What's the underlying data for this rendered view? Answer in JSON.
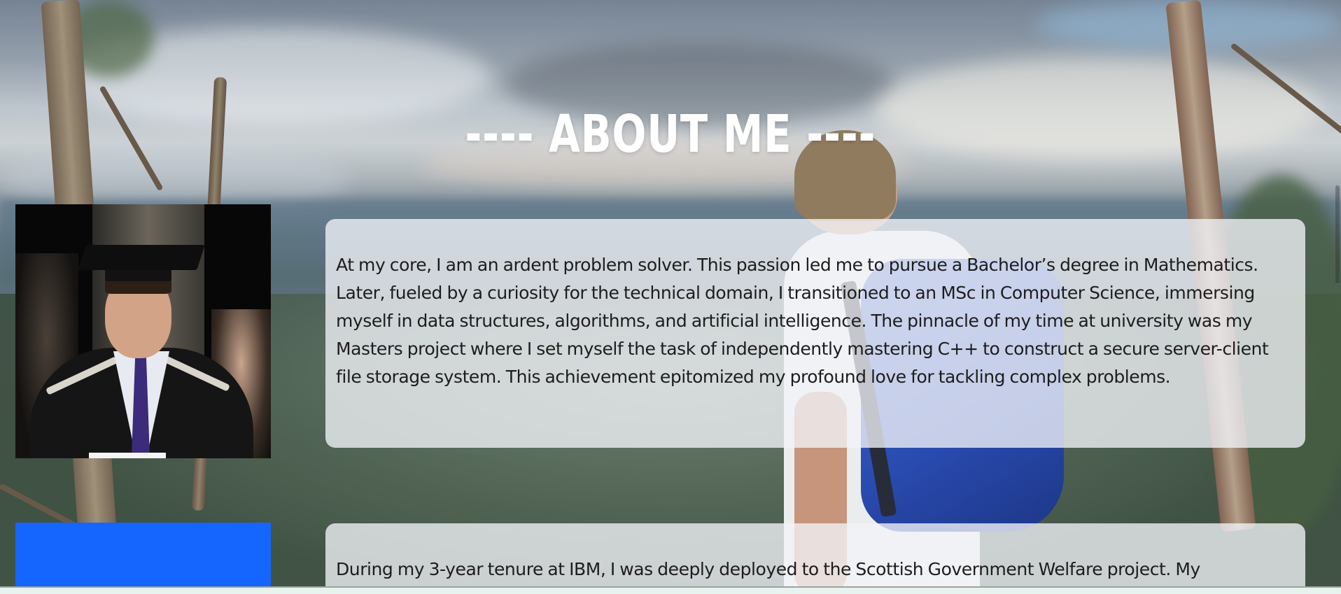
{
  "section": {
    "title": "---- ABOUT ME ----"
  },
  "cards": [
    {
      "text": "At my core, I am an ardent problem solver. This passion led me to pursue a Bachelor’s degree in Mathematics. Later, fueled by a curiosity for the technical domain, I transitioned to an MSc in Computer Science, immersing myself in data structures, algorithms, and artificial intelligence. The pinnacle of my time at university was my Masters project where I set myself the task of independently mastering C++ to construct a secure server-client file storage system. This achievement epitomized my profound love for tackling complex problems."
    },
    {
      "text": "During my 3-year tenure at IBM, I was deeply deployed to the Scottish Government Welfare project. My"
    }
  ],
  "images": {
    "graduation_photo": "graduation-portrait",
    "second_image_color": "#1565ff"
  },
  "colors": {
    "title": "#ffffff",
    "card_background": "rgba(242,244,248,0.78)",
    "body_text": "#1d1d1d"
  }
}
